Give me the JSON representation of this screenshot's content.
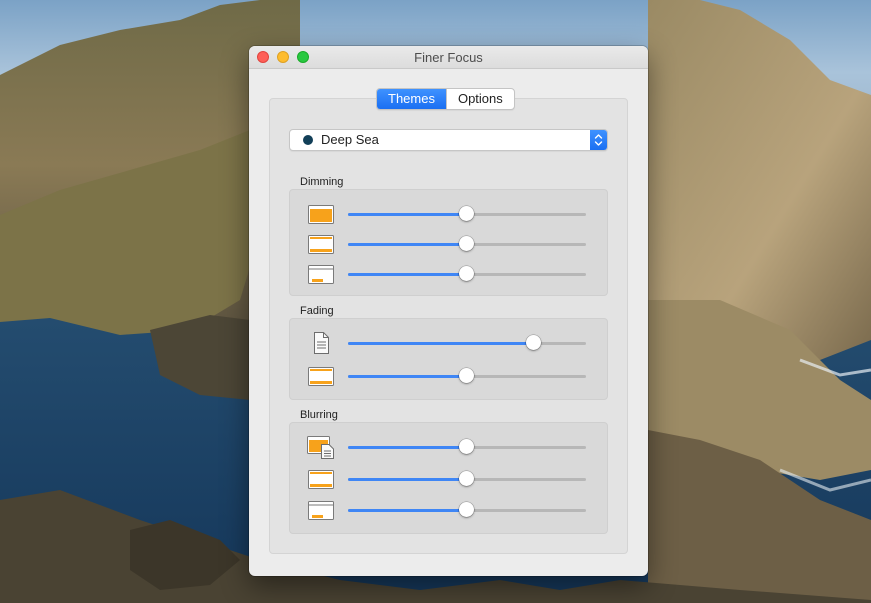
{
  "window": {
    "title": "Finer Focus"
  },
  "tabs": [
    {
      "label": "Themes",
      "active": true
    },
    {
      "label": "Options",
      "active": false
    }
  ],
  "theme_select": {
    "value": "Deep Sea",
    "color": "#123f58"
  },
  "colors": {
    "accent": "#3f86f5",
    "highlight": "#f7a21b"
  },
  "sections": [
    {
      "title": "Dimming",
      "rows": [
        {
          "icon": "window-full-highlight-icon",
          "value": 0.5
        },
        {
          "icon": "window-titlebar-highlight-icon",
          "value": 0.5
        },
        {
          "icon": "window-partial-highlight-icon",
          "value": 0.5
        }
      ]
    },
    {
      "title": "Fading",
      "rows": [
        {
          "icon": "document-icon",
          "value": 0.78
        },
        {
          "icon": "window-titlebar-highlight-icon",
          "value": 0.5
        }
      ]
    },
    {
      "title": "Blurring",
      "rows": [
        {
          "icon": "window-with-document-icon",
          "value": 0.5
        },
        {
          "icon": "window-titlebar-highlight-icon",
          "value": 0.5
        },
        {
          "icon": "window-partial-highlight-icon",
          "value": 0.5
        }
      ]
    }
  ]
}
